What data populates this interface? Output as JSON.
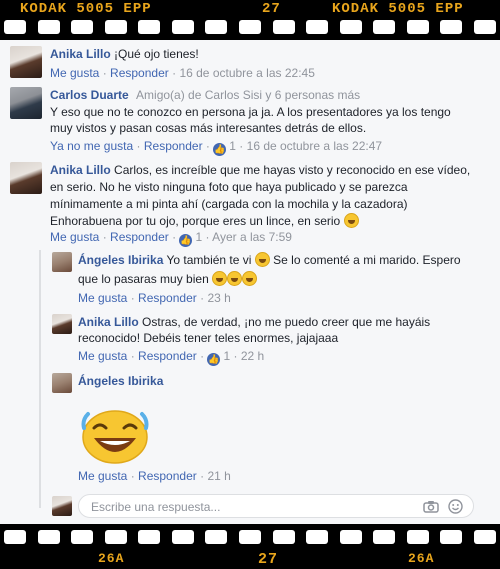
{
  "film": {
    "top_left": "KODAK 5005 EPP",
    "top_mid": "27",
    "top_right": "KODAK 5005 EPP",
    "bottom_left": "26A",
    "bottom_mid": "27",
    "bottom_right": "26A"
  },
  "comments": [
    {
      "author": "Anika Lillo",
      "text": "¡Qué ojo tienes!",
      "actions": {
        "like": "Me gusta",
        "reply": "Responder",
        "time": "16 de octubre a las 22:45"
      }
    },
    {
      "author": "Carlos Duarte",
      "friend_note": "Amigo(a) de Carlos Sisi y 6 personas más",
      "text_line1": "Y eso que no te conozco en persona ja ja. A los presentadores ya los tengo",
      "text_line2": "muy vistos y pasan cosas más interesantes detrás de ellos.",
      "actions": {
        "like": "Ya no me gusta",
        "reply": "Responder",
        "likes": "1",
        "time": "16 de octubre a las 22:47"
      }
    },
    {
      "author": "Anika Lillo",
      "text_line1": "Carlos, es increíble que me hayas visto y reconocido en ese vídeo,",
      "text_line2": "en serio. No he visto ninguna foto que haya publicado y se parezca",
      "text_line3": "mínimamente a mi pinta ahí (cargada con la mochila y la cazadora)",
      "text_line4": "Enhorabuena por tu ojo, porque eres un lince, en serio",
      "actions": {
        "like": "Me gusta",
        "reply": "Responder",
        "likes": "1",
        "time": "Ayer a las 7:59"
      }
    }
  ],
  "replies": [
    {
      "author": "Ángeles Ibirika",
      "text_part1": "Yo también te vi",
      "text_part2": "Se lo comenté a mi marido. Espero",
      "text_line2": "que lo pasaras muy bien",
      "actions": {
        "like": "Me gusta",
        "reply": "Responder",
        "time": "23 h"
      }
    },
    {
      "author": "Anika Lillo",
      "text_line1": "Ostras, de verdad, ¡no me puedo creer que me hayáis",
      "text_line2": "reconocido! Debéis tener teles enormes, jajajaaa",
      "actions": {
        "like": "Me gusta",
        "reply": "Responder",
        "likes": "1",
        "time": "22 h"
      }
    },
    {
      "author": "Ángeles Ibirika",
      "sticker": "laughing-tears-emoji-sticker",
      "actions": {
        "like": "Me gusta",
        "reply": "Responder",
        "time": "21 h"
      }
    }
  ],
  "reply_input": {
    "placeholder": "Escribe una respuesta..."
  },
  "icons": {
    "camera": "camera-icon",
    "emoji": "smiley-icon",
    "like": "thumbs-up-icon"
  },
  "colors": {
    "accent": "#4267b2",
    "name": "#365899",
    "meta": "#90949c",
    "film": "#000000",
    "film_text": "#e8a51c"
  },
  "separator": "·"
}
